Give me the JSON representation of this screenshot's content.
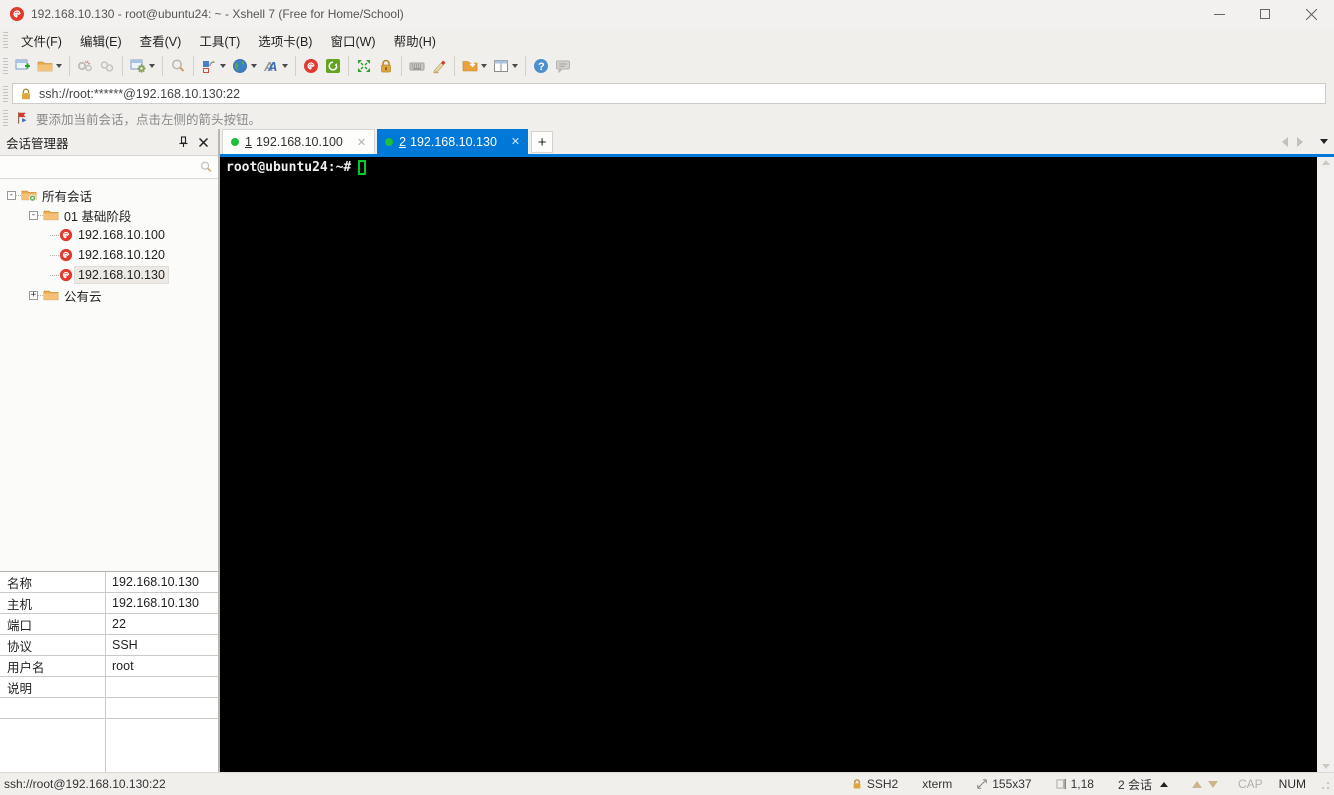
{
  "window": {
    "title": "192.168.10.130 - root@ubuntu24: ~ - Xshell 7 (Free for Home/School)"
  },
  "menu": {
    "items": [
      "文件(F)",
      "编辑(E)",
      "查看(V)",
      "工具(T)",
      "选项卡(B)",
      "窗口(W)",
      "帮助(H)"
    ]
  },
  "toolbar": {
    "icons": [
      "new-session-icon",
      "open-folder-icon",
      "disconnect-icon",
      "reconnect-icon",
      "session-properties-icon",
      "find-icon",
      "compose-bar-icon",
      "web-icon",
      "font-icon",
      "xshell-icon",
      "xftp-icon",
      "fullscreen-icon",
      "lock-icon",
      "keyboard-icon",
      "highlight-pen-icon",
      "new-file-icon",
      "layout-icon",
      "help-icon",
      "chat-icon"
    ]
  },
  "addressbar": {
    "value": "ssh://root:******@192.168.10.130:22"
  },
  "infobar": {
    "text": "要添加当前会话，点击左侧的箭头按钮。"
  },
  "sidebar": {
    "title": "会话管理器",
    "tree": [
      {
        "label": "所有会话"
      },
      {
        "label": "01 基础阶段"
      },
      {
        "label": "192.168.10.100"
      },
      {
        "label": "192.168.10.120"
      },
      {
        "label": "192.168.10.130"
      },
      {
        "label": "公有云"
      }
    ],
    "properties": [
      {
        "label": "名称",
        "value": "192.168.10.130"
      },
      {
        "label": "主机",
        "value": "192.168.10.130"
      },
      {
        "label": "端口",
        "value": "22"
      },
      {
        "label": "协议",
        "value": "SSH"
      },
      {
        "label": "用户名",
        "value": "root"
      },
      {
        "label": "说明",
        "value": ""
      }
    ]
  },
  "tabs": [
    {
      "num": "1",
      "label": "192.168.10.100",
      "close": "✕"
    },
    {
      "num": "2",
      "label": "192.168.10.130",
      "close": "✕"
    }
  ],
  "tab_plus": "+",
  "terminal": {
    "prompt": "root@ubuntu24:~#"
  },
  "statusbar": {
    "left": "ssh://root@192.168.10.130:22",
    "protocol": "SSH2",
    "term_type": "xterm",
    "size": "155x37",
    "cursor_pos": "1,18",
    "sessions": "2 会话",
    "cap": "CAP",
    "num": "NUM"
  },
  "colors": {
    "accent": "#0078d7",
    "terminal_bg": "#000000",
    "cursor_green": "#00cc22",
    "snail_red": "#e03a2f",
    "folder_orange": "#f0a63c",
    "tab_green_dot": "#1fbf3a"
  }
}
